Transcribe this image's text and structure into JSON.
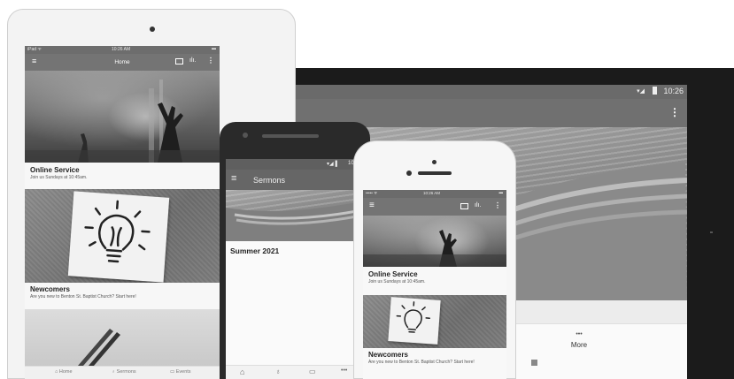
{
  "ipad": {
    "status": {
      "carrier": "iPad ᯤ",
      "time": "10:26 AM",
      "battery": "▬"
    },
    "appbar": {
      "title": "Home"
    },
    "cards": [
      {
        "title": "Online Service",
        "subtitle": "Join us Sundays at 10:45am."
      },
      {
        "title": "Newcomers",
        "subtitle": "Are you new to Benton St. Baptist Church? Start here!"
      }
    ],
    "nav": [
      {
        "label": "Home",
        "icon": "home-icon"
      },
      {
        "label": "Sermons",
        "icon": "microphone-icon"
      },
      {
        "label": "Events",
        "icon": "calendar-icon"
      }
    ]
  },
  "android": {
    "status": {
      "time": "10"
    },
    "appbar": {
      "title": "Sermons"
    },
    "series": [
      {
        "title": "Summer 2021"
      }
    ],
    "nav_more": "•••"
  },
  "iphone": {
    "status": {
      "carrier": "••••• ᯤ",
      "time": "10:26 AM",
      "battery": "▬"
    },
    "cards": [
      {
        "title": "Online Service",
        "subtitle": "Join us Sundays at 10:45am."
      },
      {
        "title": "Newcomers",
        "subtitle": "Are you new to Benton St. Baptist Church? Start here!"
      }
    ]
  },
  "tablet": {
    "status": {
      "time": "10:26"
    },
    "nav": {
      "more_glyph": "•••",
      "more_label": "More"
    }
  },
  "colors": {
    "appbar": "#707070",
    "statusbar": "#6a6a6a",
    "bezel_dark": "#1b1b1b",
    "bezel_light": "#f3f3f3"
  }
}
